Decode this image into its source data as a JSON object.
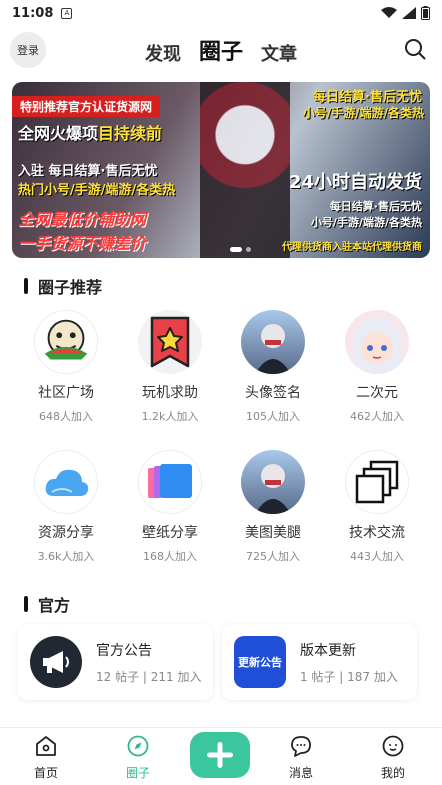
{
  "status": {
    "time": "11:08",
    "sim_glyph": "A"
  },
  "header": {
    "login_label": "登录",
    "tabs": [
      "发现",
      "圈子",
      "文章"
    ],
    "active_tab": "圈子"
  },
  "banner": {
    "tag": "特别推荐官方认证货源网",
    "title_prefix": "全网火爆项",
    "title_highlight": "目持续前",
    "line1": "入驻 每日结算·售后无忧",
    "line2": "热门小号/手游/端游/各类热",
    "big1": "全网最低价辅助网",
    "big2": "一手货源不赚差价",
    "right1": "每日结算·售后无忧",
    "right2": "小号/手游/端游/各类热",
    "right3": "24小时自动发货",
    "right4": "每日结算·售后无忧",
    "right5": "小号/手游/端游/各类热",
    "right6": "代理供货商入驻本站代理供货商"
  },
  "recommend": {
    "title": "圈子推荐",
    "items": [
      {
        "name": "社区广场",
        "count": "648人加入",
        "icon": "meme-face-icon",
        "sticker": "吃瓜看戏"
      },
      {
        "name": "玩机求助",
        "count": "1.2k人加入",
        "icon": "star-bookmark-icon"
      },
      {
        "name": "头像签名",
        "count": "105人加入",
        "icon": "avatar-girl-icon"
      },
      {
        "name": "二次元",
        "count": "462人加入",
        "icon": "anime-girl-icon"
      },
      {
        "name": "资源分享",
        "count": "3.6k人加入",
        "icon": "cloud-icon"
      },
      {
        "name": "壁纸分享",
        "count": "168人加入",
        "icon": "wallpaper-cards-icon"
      },
      {
        "name": "美图美腿",
        "count": "725人加入",
        "icon": "photo-girl-icon"
      },
      {
        "name": "技术交流",
        "count": "443人加入",
        "icon": "stacked-windows-icon"
      }
    ]
  },
  "official": {
    "title": "官方",
    "cards": [
      {
        "title": "官方公告",
        "meta": "12 帖子 | 211 加入",
        "icon": "megaphone-icon"
      },
      {
        "title": "版本更新",
        "meta": "1 帖子 | 187 加入",
        "icon": "update-notice-icon",
        "icon_text": "更新公告"
      }
    ]
  },
  "tabbar": {
    "items": [
      {
        "label": "首页",
        "icon": "home-icon"
      },
      {
        "label": "圈子",
        "icon": "compass-icon"
      },
      {
        "label": "消息",
        "icon": "chat-icon"
      },
      {
        "label": "我的",
        "icon": "profile-icon"
      }
    ],
    "active": "圈子",
    "accent": "#3cc69e"
  }
}
